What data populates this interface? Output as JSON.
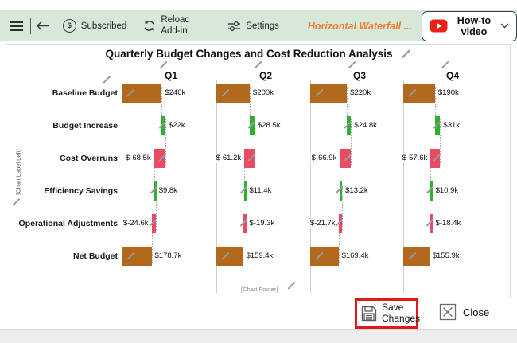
{
  "header": {
    "subscription_glyph": "$",
    "subscribed_label": "Subscribed",
    "reload_label": "Reload Add-in",
    "settings_label": "Settings",
    "addin_name": "Horizontal Waterfall ...",
    "howto_video_label": "How-to video"
  },
  "chart_data": {
    "type": "waterfall",
    "orientation": "horizontal",
    "title": "Quarterly Budget Changes and Cost Reduction Analysis",
    "left_label": "[Chart Label Left]",
    "footer": "[Chart Footer]",
    "categories": [
      "Baseline Budget",
      "Budget Increase",
      "Cost Overruns",
      "Efficiency Savings",
      "Operational Adjustments",
      "Net Budget"
    ],
    "units": "USD thousands",
    "series": [
      {
        "name": "Q1",
        "values": [
          240,
          22,
          -68.5,
          9.8,
          -24.6,
          178.7
        ],
        "labels": [
          "$240k",
          "$22k",
          "$-68.5k",
          "$9.8k",
          "$-24.6k",
          "$178.7k"
        ],
        "label_sides": [
          "right",
          "right",
          "left",
          "right",
          "left",
          "right"
        ]
      },
      {
        "name": "Q2",
        "values": [
          200,
          28.5,
          -61.2,
          11.4,
          -19.3,
          159.4
        ],
        "labels": [
          "$200k",
          "$28.5k",
          "$-61.2k",
          "$11.4k",
          "$-19.3k",
          "$159.4k"
        ],
        "label_sides": [
          "right",
          "right",
          "left",
          "right",
          "right",
          "right"
        ]
      },
      {
        "name": "Q3",
        "values": [
          220,
          24.8,
          -66.9,
          13.2,
          -21.7,
          169.4
        ],
        "labels": [
          "$220k",
          "$24.8k",
          "$-66.9k",
          "$13.2k",
          "$-21.7k",
          "$169.4k"
        ],
        "label_sides": [
          "right",
          "right",
          "left",
          "right",
          "left",
          "right"
        ]
      },
      {
        "name": "Q4",
        "values": [
          190,
          31,
          -57.6,
          10.9,
          -18.4,
          155.9
        ],
        "labels": [
          "$190k",
          "$31k",
          "$-57.6k",
          "$10.9k",
          "$-18.4k",
          "$155.9k"
        ],
        "label_sides": [
          "right",
          "right",
          "left",
          "right",
          "right",
          "right"
        ]
      }
    ],
    "colors": {
      "baseline": "#b2691e",
      "increase": "#2bb32b",
      "decrease": "#e84b63"
    }
  },
  "footer_bar": {
    "save_label": "Save Changes",
    "close_label": "Close"
  }
}
